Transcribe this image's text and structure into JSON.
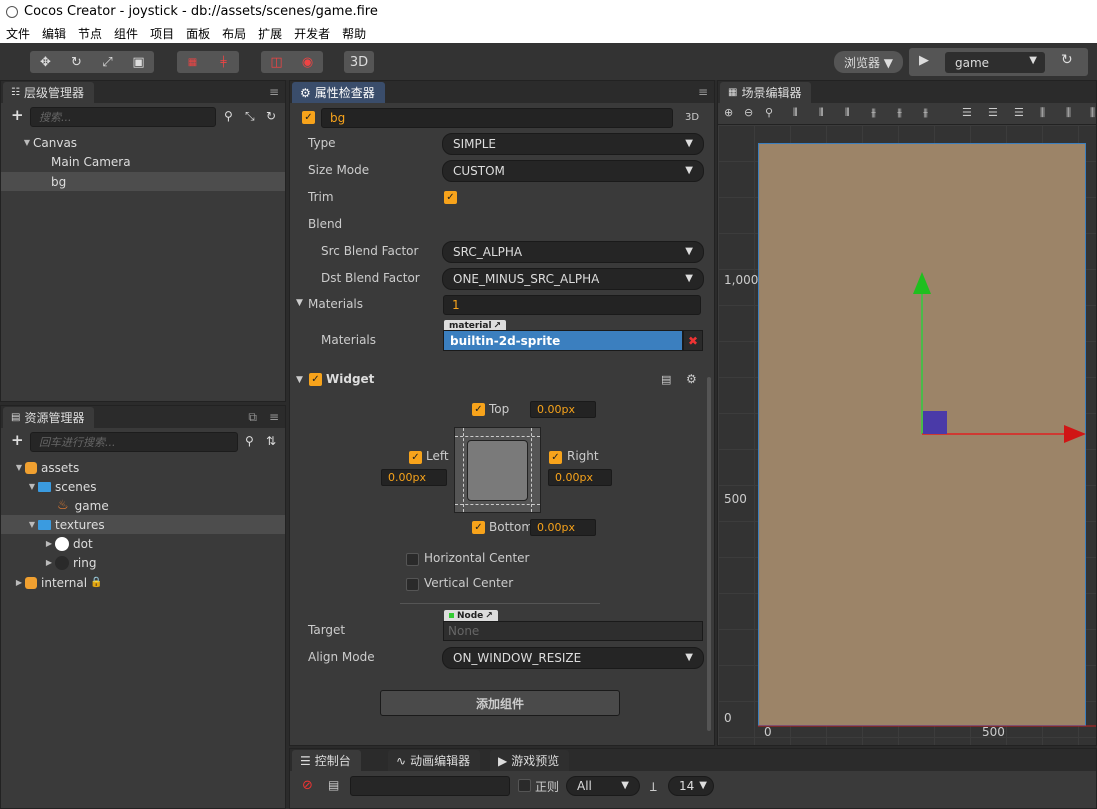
{
  "window": {
    "title": "Cocos Creator - joystick - db://assets/scenes/game.fire"
  },
  "menubar": {
    "items": [
      "文件",
      "编辑",
      "节点",
      "组件",
      "项目",
      "面板",
      "布局",
      "扩展",
      "开发者",
      "帮助"
    ]
  },
  "toolbar": {
    "mode_3d_label": "3D",
    "browser_label": "浏览器 ▼",
    "scene_select_value": "game"
  },
  "hierarchy": {
    "tab_label": "层级管理器",
    "search_placeholder": "搜索...",
    "nodes": [
      {
        "label": "Canvas"
      },
      {
        "label": "Main Camera"
      },
      {
        "label": "bg"
      }
    ]
  },
  "assets": {
    "tab_label": "资源管理器",
    "search_placeholder": "回车进行搜索...",
    "items": [
      {
        "label": "assets"
      },
      {
        "label": "scenes"
      },
      {
        "label": "game"
      },
      {
        "label": "textures"
      },
      {
        "label": "dot"
      },
      {
        "label": "ring"
      },
      {
        "label": "internal"
      }
    ]
  },
  "inspector": {
    "tab_label": "属性检查器",
    "node_name": "bg",
    "badge_3d": "3D",
    "sprite": {
      "type_label": "Type",
      "type_value": "SIMPLE",
      "size_mode_label": "Size Mode",
      "size_mode_value": "CUSTOM",
      "trim_label": "Trim",
      "blend_label": "Blend",
      "src_label": "Src Blend Factor",
      "src_value": "SRC_ALPHA",
      "dst_label": "Dst Blend Factor",
      "dst_value": "ONE_MINUS_SRC_ALPHA",
      "materials_label": "Materials",
      "materials_count": "1",
      "material_tag": "material",
      "material_item_label": "Materials",
      "material_value": "builtin-2d-sprite"
    },
    "widget": {
      "title": "Widget",
      "top_label": "Top",
      "top_value": "0.00px",
      "left_label": "Left",
      "left_value": "0.00px",
      "right_label": "Right",
      "right_value": "0.00px",
      "bottom_label": "Bottom",
      "bottom_value": "0.00px",
      "hcenter_label": "Horizontal Center",
      "vcenter_label": "Vertical Center",
      "node_tag": "Node",
      "target_label": "Target",
      "target_value": "None",
      "align_label": "Align Mode",
      "align_value": "ON_WINDOW_RESIZE"
    },
    "add_component_label": "添加组件"
  },
  "scene": {
    "tab_label": "场景编辑器",
    "axis_labels": {
      "y1000": "1,000",
      "y500": "500",
      "y0": "0",
      "x0": "0",
      "x500": "500"
    },
    "canvas_color": "#9c8468"
  },
  "console": {
    "tabs": [
      "控制台",
      "动画编辑器",
      "游戏预览"
    ],
    "regex_label": "正则",
    "filter_value": "All",
    "font_size_value": "14"
  },
  "colors": {
    "accent": "#f7a31b",
    "selection": "#3b7fbf"
  }
}
